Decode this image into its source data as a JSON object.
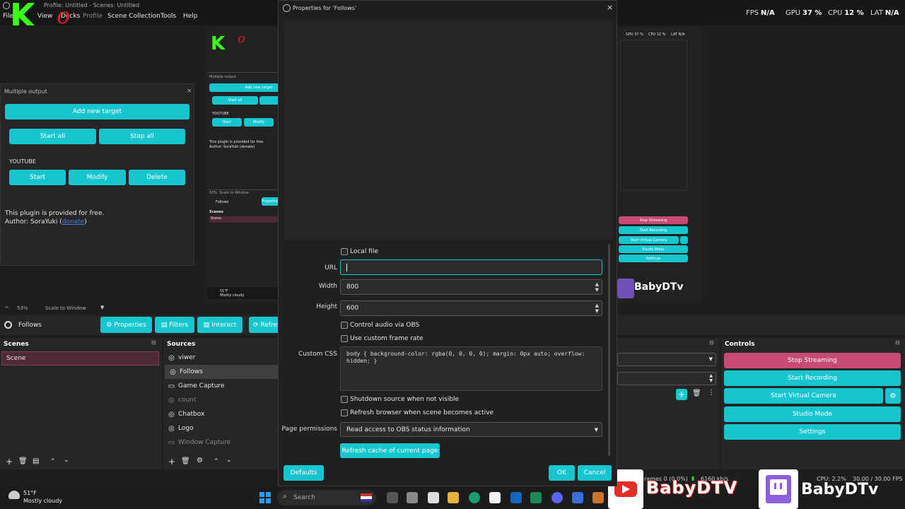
{
  "window": {
    "title": "Profile: Untitled - Scenes: Untitled",
    "menu": [
      "File",
      "View",
      "Docks",
      "Profile",
      "Scene Collection",
      "Tools",
      "Help"
    ]
  },
  "stats": {
    "fps_label": "FPS",
    "fps_value": "N/A",
    "gpu_label": "GPU",
    "gpu_value": "37 %",
    "cpu_label": "CPU",
    "cpu_value": "12 %",
    "lat_label": "LAT",
    "lat_value": "N/A"
  },
  "logo": {
    "letter": "K",
    "suffix": "o"
  },
  "multiple_output": {
    "title": "Multiple output",
    "add_target": "Add new target",
    "start_all": "Start all",
    "stop_all": "Stop all",
    "platform": "YOUTUBE",
    "start": "Start",
    "modify": "Modify",
    "delete": "Delete",
    "free_text": "This plugin is provided for free.",
    "author_prefix": "Author: SoraYuki (",
    "donate": "donate",
    "author_suffix": ")"
  },
  "preview_toolbar": {
    "zoom": "53%",
    "scale": "Scale to Window"
  },
  "source_toolbar": {
    "source_name": "Follows",
    "properties": "Properties",
    "filters": "Filters",
    "interact": "Interact",
    "refresh": "Refresh"
  },
  "scenes": {
    "title": "Scenes",
    "items": [
      "Scene"
    ]
  },
  "sources": {
    "title": "Sources",
    "items": [
      {
        "name": "viwer",
        "icon": "globe-icon"
      },
      {
        "name": "Follows",
        "icon": "globe-icon"
      },
      {
        "name": "Game Capture",
        "icon": "gamepad-icon"
      },
      {
        "name": "count",
        "icon": "globe-icon"
      },
      {
        "name": "Chatbox",
        "icon": "globe-icon"
      },
      {
        "name": "Logo",
        "icon": "image-icon"
      },
      {
        "name": "Window Capture",
        "icon": "window-icon"
      }
    ]
  },
  "controls": {
    "title": "Controls",
    "stop_streaming": "Stop Streaming",
    "start_recording": "Start Recording",
    "start_virtual_camera": "Start Virtual Camera",
    "studio_mode": "Studio Mode",
    "settings": "Settings"
  },
  "nested_preview": {
    "gpu": "GPU 37 %",
    "cpu": "CPU 12 %",
    "lat": "LAT N/A",
    "stop_streaming": "Stop Streaming",
    "start_recording": "Start Recording",
    "start_virtual_camera": "Start Virtual Camera",
    "studio_mode": "Studio Mode",
    "settings": "Settings",
    "title": "Multiple output",
    "add_target": "Add new target",
    "start_all": "Start all",
    "platform": "YOUTUBE",
    "start": "Start",
    "modify": "Modify",
    "free_text": "This plugin is provided for free.",
    "author": "Author: SoraYuki (donate)",
    "zoom": "53%",
    "scale": "Scale to Window",
    "source": "Follows",
    "props": "Properties",
    "scenes": "Scenes",
    "scene": "Scene",
    "weather_temp": "51°F",
    "weather_desc": "Mostly cloudy",
    "status": "CPU 2.2%  30.00 / 30.00 FPS"
  },
  "dialog": {
    "title": "Properties for 'Follows'",
    "local_file": "Local file",
    "url_label": "URL",
    "url_value": "",
    "width_label": "Width",
    "width_value": "800",
    "height_label": "Height",
    "height_value": "600",
    "control_audio": "Control audio via OBS",
    "custom_frame_rate": "Use custom frame rate",
    "css_label": "Custom CSS",
    "css_value": "body { background-color: rgba(0, 0, 0, 0); margin: 0px auto; overflow: hidden; }",
    "shutdown": "Shutdown source when not visible",
    "refresh_active": "Refresh browser when scene becomes active",
    "perm_label": "Page permissions",
    "perm_value": "Read access to OBS status information",
    "refresh_cache": "Refresh cache of current page",
    "defaults": "Defaults",
    "ok": "OK",
    "cancel": "Cancel"
  },
  "status_bar": {
    "frames": "rames 0 (0.0%)",
    "kbps": "6160 kb/s",
    "cpu": "CPU: 2.2%",
    "fps": "30.00 / 30.00 FPS"
  },
  "taskbar": {
    "weather_temp": "51°F",
    "weather_desc": "Mostly cloudy",
    "search": "Search"
  },
  "overlay": {
    "channel_youtube": "BabyDTV",
    "channel_twitch": "BabyDTv",
    "nested_channel": "BabyDTv"
  },
  "colors": {
    "accent": "#17c6cf",
    "streaming": "#c64a74",
    "logo_green": "#39ff14",
    "logo_red": "#e3131b"
  }
}
